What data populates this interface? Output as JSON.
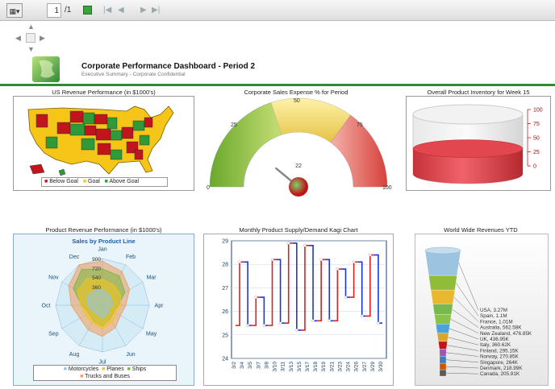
{
  "toolbar": {
    "page_current": "1",
    "page_total": "/1",
    "icons": [
      "settings-icon",
      "export-icon",
      "first-page-icon",
      "prev-page-icon",
      "next-page-icon",
      "last-page-icon"
    ]
  },
  "header": {
    "title": "Corporate Performance Dashboard - Period 2",
    "subtitle": "Executive Summary - Corporate Confidential"
  },
  "panels": {
    "us_revenue": {
      "title": "US Revenue Performance (in $1000's)",
      "legend": [
        "Below Goal",
        "Goal",
        "Above Goal"
      ],
      "colors": {
        "below": "#c0161b",
        "goal": "#f5c518",
        "above": "#2e9a38"
      }
    },
    "sales_expense": {
      "title": "Corporate Sales Expense % for Period",
      "ticks": [
        "0",
        "25",
        "50",
        "75",
        "100"
      ],
      "value": "22"
    },
    "inventory": {
      "title": "Overall Product Inventory for Week 15",
      "ticks": [
        "100",
        "75",
        "50",
        "25",
        "0"
      ]
    },
    "product_revenue": {
      "title": "Product Revenue Performance (in $1000's)",
      "chart_title": "Sales by Product Line",
      "months": [
        "Jan",
        "Feb",
        "Mar",
        "Apr",
        "May",
        "Jun",
        "Jul",
        "Aug",
        "Sep",
        "Oct",
        "Nov",
        "Dec"
      ],
      "radial_ticks": [
        "900",
        "720",
        "540",
        "360"
      ],
      "legend": [
        "Motorcycles",
        "Planes",
        "Ships",
        "Trucks and Buses"
      ]
    },
    "kagi": {
      "title": "Monthly Product Supply/Demand Kagi Chart",
      "y_ticks": [
        "29",
        "28",
        "27",
        "26",
        "25",
        "24"
      ],
      "x_labels": [
        "3/2",
        "3/4",
        "3/5",
        "3/7",
        "3/8",
        "3/10",
        "3/11",
        "3/13",
        "3/15",
        "3/17",
        "3/18",
        "3/19",
        "3/21",
        "3/23",
        "3/24",
        "3/26",
        "3/27",
        "3/29",
        "3/30"
      ]
    },
    "world": {
      "title": "World Wide Revenues YTD",
      "labels": [
        "USA, 3.27M",
        "Spain, 1.1M",
        "France, 1.01M",
        "Australia, 562.58K",
        "New Zealand, 476.85K",
        "UK, 436.95K",
        "Italy, 360.62K",
        "Finland, 295.15K",
        "Norway, 270.85K",
        "Singapore, 264K",
        "Denmark, 218.99K",
        "Canada, 205.91K"
      ]
    }
  },
  "chart_data": [
    {
      "type": "gauge",
      "title": "Corporate Sales Expense % for Period",
      "value": 22,
      "range": [
        0,
        100
      ],
      "bands": [
        {
          "from": 0,
          "to": 40,
          "color": "green"
        },
        {
          "from": 40,
          "to": 70,
          "color": "yellow"
        },
        {
          "from": 70,
          "to": 100,
          "color": "red"
        }
      ]
    },
    {
      "type": "cylinder",
      "title": "Overall Product Inventory for Week 15",
      "value": 50,
      "range": [
        0,
        100
      ]
    },
    {
      "type": "line",
      "subtype": "kagi",
      "title": "Monthly Product Supply/Demand Kagi Chart",
      "ylim": [
        24,
        29
      ],
      "x": [
        "3/2",
        "3/4",
        "3/5",
        "3/7",
        "3/8",
        "3/10",
        "3/11",
        "3/13",
        "3/15",
        "3/17",
        "3/18",
        "3/19",
        "3/21",
        "3/23",
        "3/24",
        "3/26",
        "3/27",
        "3/29",
        "3/30"
      ],
      "values": [
        25.4,
        28.1,
        25.4,
        26.6,
        25.4,
        28.2,
        25.5,
        28.9,
        25.2,
        28.8,
        25.6,
        28.2,
        25.6,
        27.8,
        26.6,
        28.1,
        25.8,
        28.4,
        25.5
      ]
    },
    {
      "type": "radar",
      "title": "Sales by Product Line",
      "categories": [
        "Jan",
        "Feb",
        "Mar",
        "Apr",
        "May",
        "Jun",
        "Jul",
        "Aug",
        "Sep",
        "Oct",
        "Nov",
        "Dec"
      ],
      "series": [
        {
          "name": "Motorcycles",
          "values": [
            300,
            250,
            200,
            180,
            150,
            200,
            250,
            200,
            220,
            280,
            350,
            320
          ]
        },
        {
          "name": "Planes",
          "values": [
            500,
            450,
            400,
            350,
            300,
            380,
            450,
            400,
            380,
            420,
            550,
            600
          ]
        },
        {
          "name": "Ships",
          "values": [
            700,
            650,
            500,
            300,
            250,
            300,
            400,
            350,
            300,
            400,
            650,
            800
          ]
        },
        {
          "name": "Trucks and Buses",
          "values": [
            850,
            750,
            600,
            450,
            400,
            500,
            600,
            550,
            500,
            600,
            750,
            900
          ]
        }
      ]
    },
    {
      "type": "funnel",
      "title": "World Wide Revenues YTD",
      "categories": [
        "USA",
        "Spain",
        "France",
        "Australia",
        "New Zealand",
        "UK",
        "Italy",
        "Finland",
        "Norway",
        "Singapore",
        "Denmark",
        "Canada"
      ],
      "values": [
        3270000,
        1100000,
        1010000,
        562580,
        476850,
        436950,
        360620,
        295150,
        270850,
        264000,
        218990,
        205910
      ]
    }
  ]
}
